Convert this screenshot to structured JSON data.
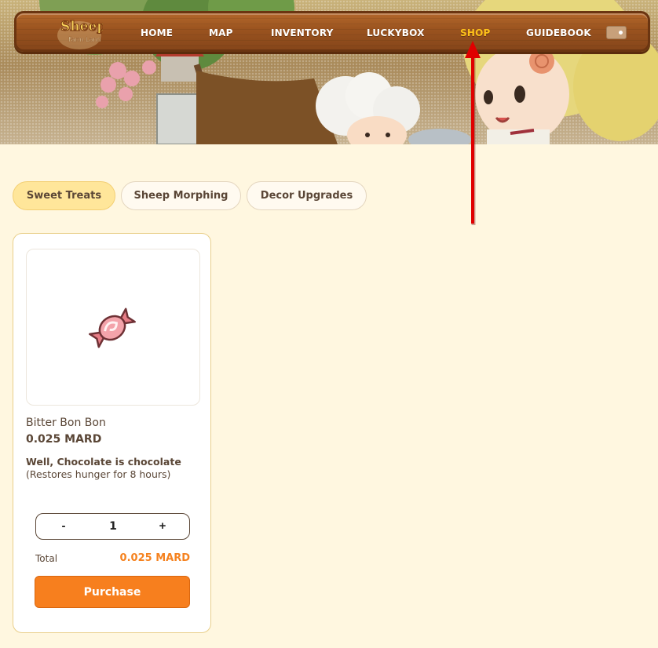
{
  "header": {
    "logo_text": "Sheep Farm Land",
    "nav": {
      "home": "HOME",
      "map": "MAP",
      "inventory": "INVENTORY",
      "luckybox": "LUCKYBOX",
      "shop": "SHOP",
      "guidebook": "GUIDEBOOK"
    },
    "active_item": "SHOP",
    "active_color": "#ffc21a"
  },
  "tabs": {
    "items": [
      "Sweet Treats",
      "Sheep Morphing",
      "Decor Upgrades"
    ],
    "active": "Sweet Treats"
  },
  "product": {
    "icon": "candy-icon",
    "name": "Bitter Bon Bon",
    "price": "0.025 MARD",
    "description": "Well, Chocolate is chocolate",
    "effect": "(Restores hunger for 8 hours)",
    "quantity": {
      "minus": "-",
      "value": "1",
      "plus": "+"
    },
    "total_label": "Total",
    "total_value": "0.025 MARD",
    "purchase_label": "Purchase"
  },
  "colors": {
    "accent_orange": "#f77f1e",
    "active_tab": "#ffe69a",
    "background": "#fff7e0",
    "annotation_arrow": "#e00000"
  }
}
